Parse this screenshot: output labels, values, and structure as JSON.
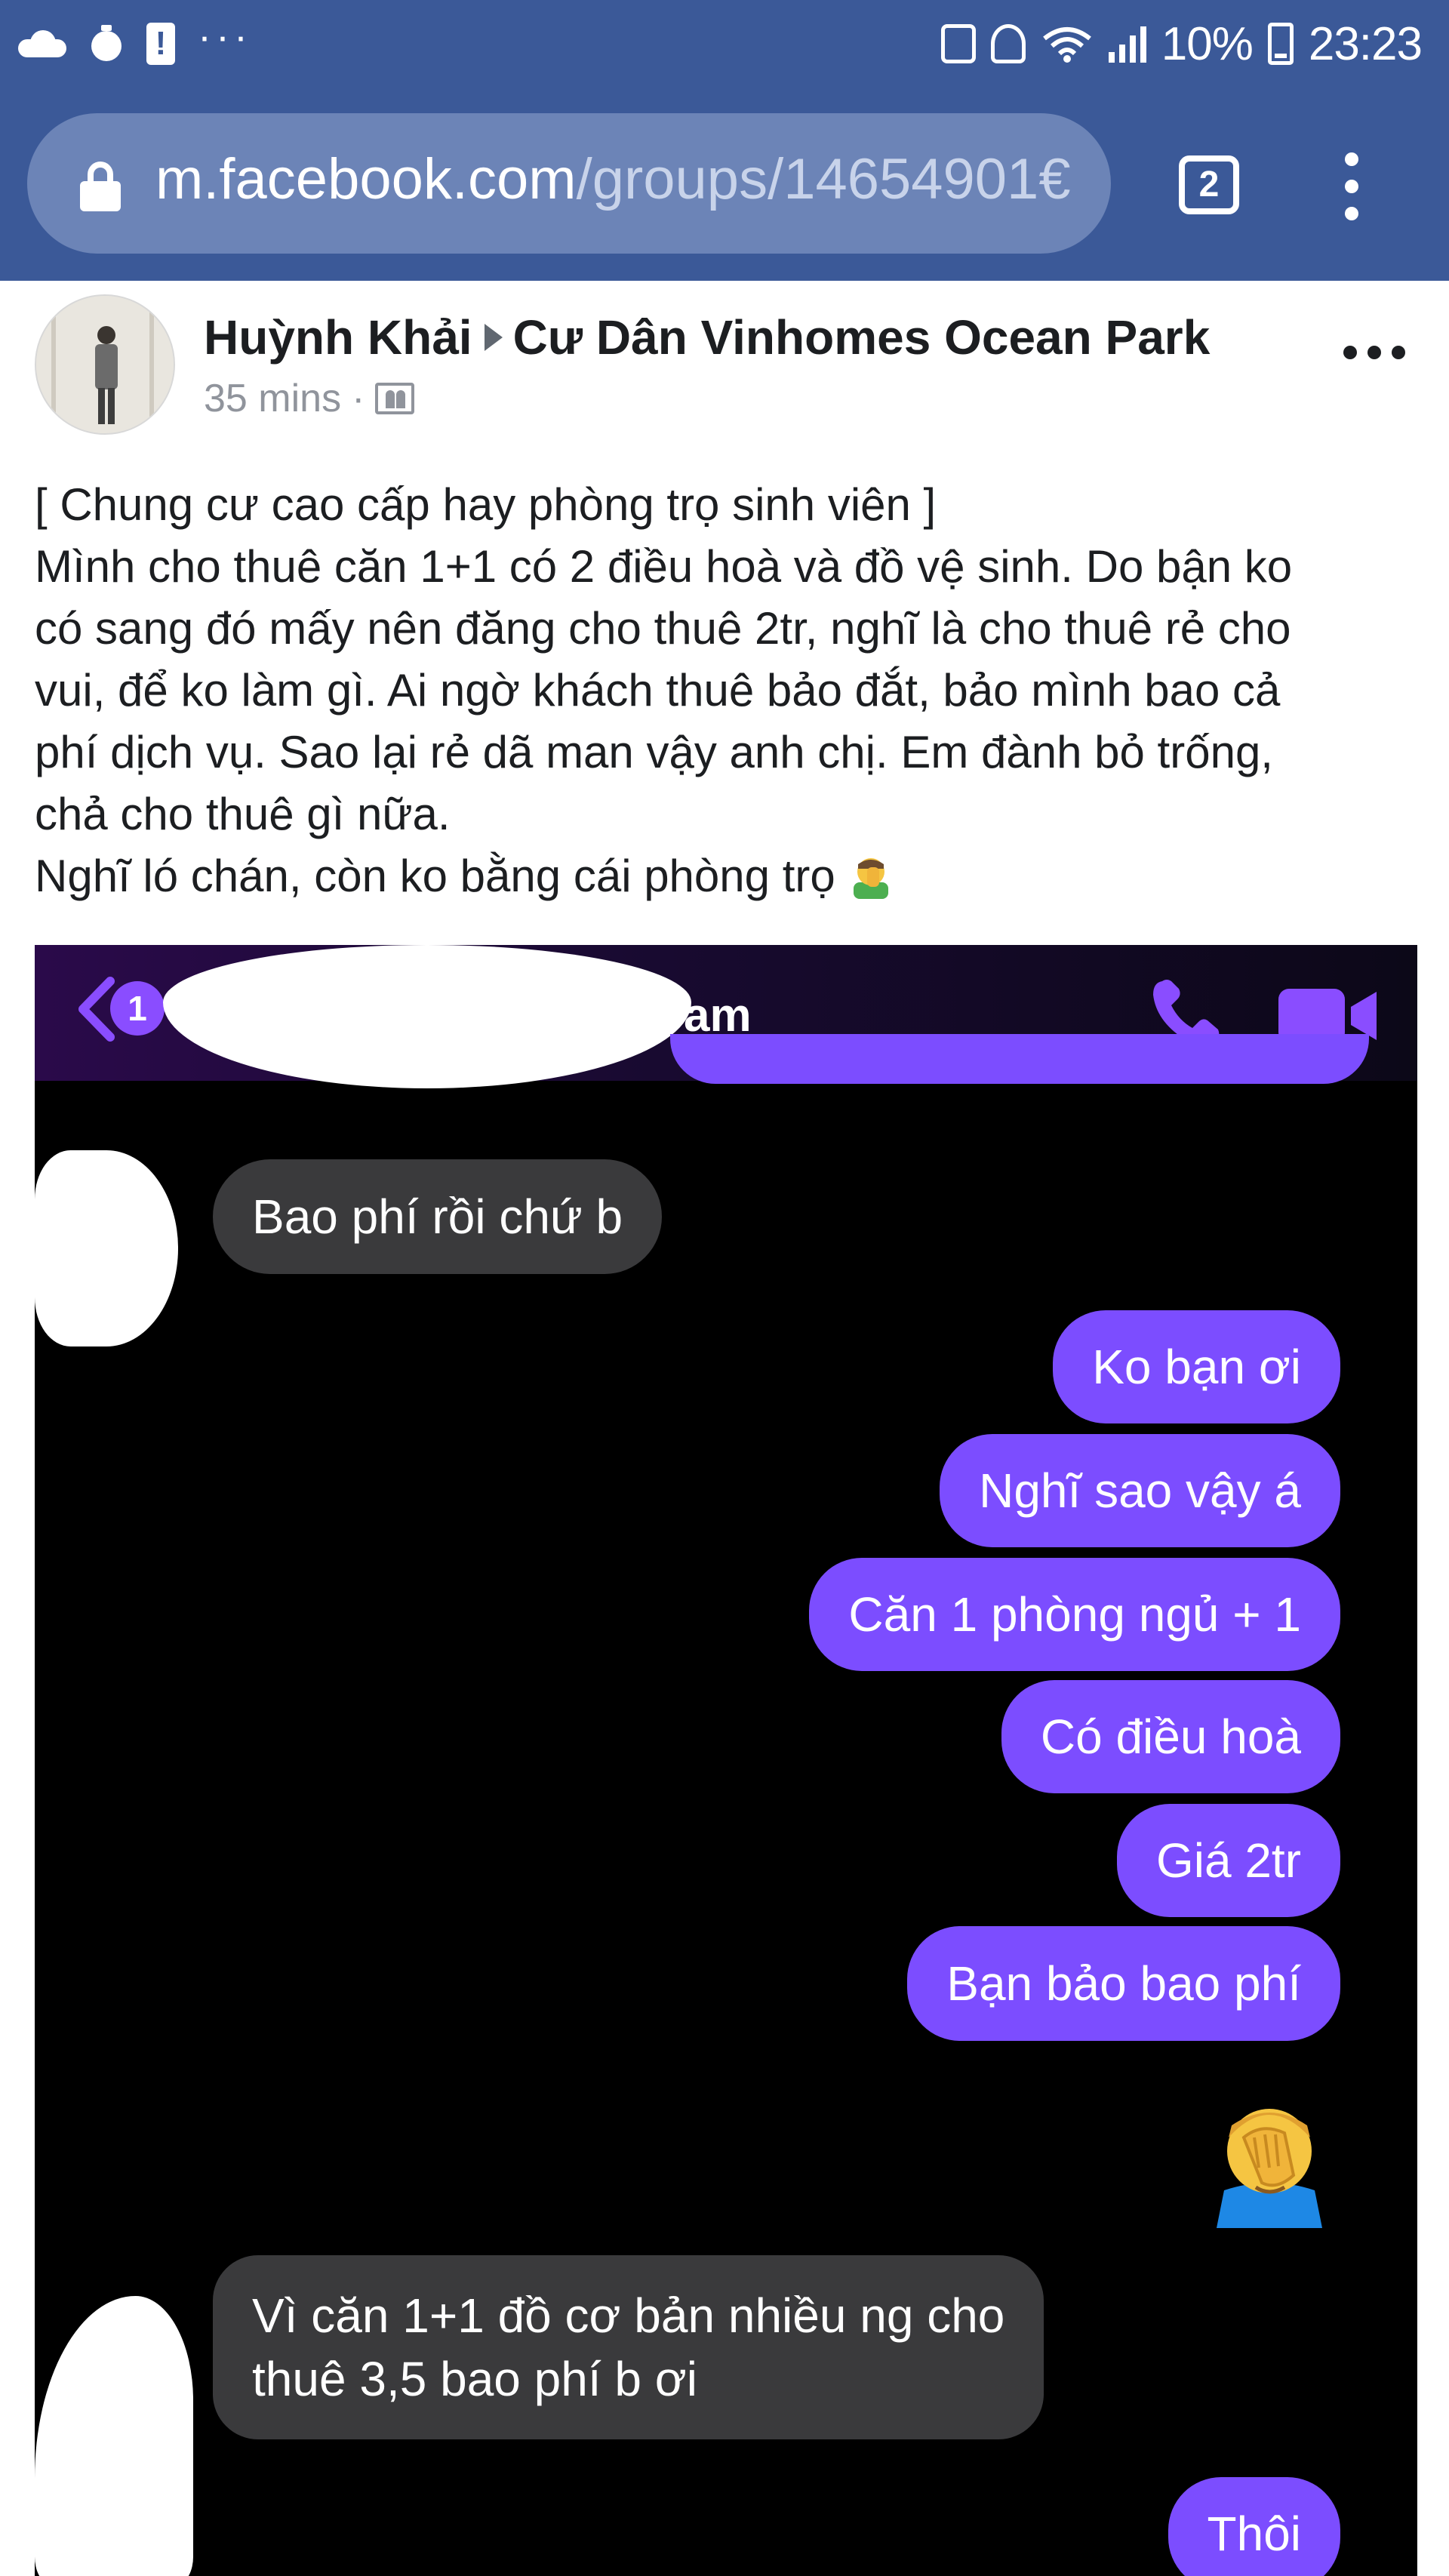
{
  "status_bar": {
    "battery": "10%",
    "time": "23:23",
    "left_icons": [
      "cloud-icon",
      "timer-icon",
      "alert-icon",
      "more-dots-icon"
    ],
    "more_dots": "···"
  },
  "browser": {
    "url_host": "m.facebook.com",
    "url_path": "/groups/14654901€",
    "tab_count": "2"
  },
  "post": {
    "author": "Huỳnh Khải",
    "group": "Cư Dân Vinhomes Ocean Park",
    "time": "35 mins",
    "separator": "·",
    "lines": [
      "[ Chung cư cao cấp hay phòng trọ sinh viên ]",
      "Mình cho thuê căn 1+1 có 2 điều hoà và đồ vệ sinh. Do bận ko",
      "có sang đó mấy nên đăng cho thuê 2tr, nghĩ là cho thuê rẻ cho",
      "vui, để ko làm gì. Ai ngờ khách thuê bảo đắt, bảo mình bao cả",
      "phí dịch vụ. Sao lại rẻ dã man vậy anh chị. Em đành bỏ trống,",
      "chả cho thuê gì nữa.",
      "Nghĩ ló chán, còn ko bằng cái phòng trọ"
    ]
  },
  "chat": {
    "back_badge": "1",
    "contact_tail": "ạm",
    "messages": [
      {
        "side": "in",
        "text": "Bao phí rồi chứ b"
      },
      {
        "side": "out",
        "text": "Ko bạn ơi"
      },
      {
        "side": "out",
        "text": "Nghĩ sao vậy á"
      },
      {
        "side": "out",
        "text": "Căn 1 phòng ngủ + 1"
      },
      {
        "side": "out",
        "text": "Có điều hoà"
      },
      {
        "side": "out",
        "text": "Giá 2tr"
      },
      {
        "side": "out",
        "text": "Bạn bảo bao phí"
      },
      {
        "side": "in",
        "text_lines": [
          "Vì căn 1+1 đồ cơ bản nhiều ng cho",
          "thuê 3,5 bao phí b ơi"
        ]
      },
      {
        "side": "out",
        "text": "Thôi"
      }
    ]
  },
  "colors": {
    "facebook_blue": "#3b5998",
    "url_bar": "#6c84b7",
    "outgoing_bubble": "#7c4dff",
    "incoming_bubble": "#3a3a3c"
  }
}
